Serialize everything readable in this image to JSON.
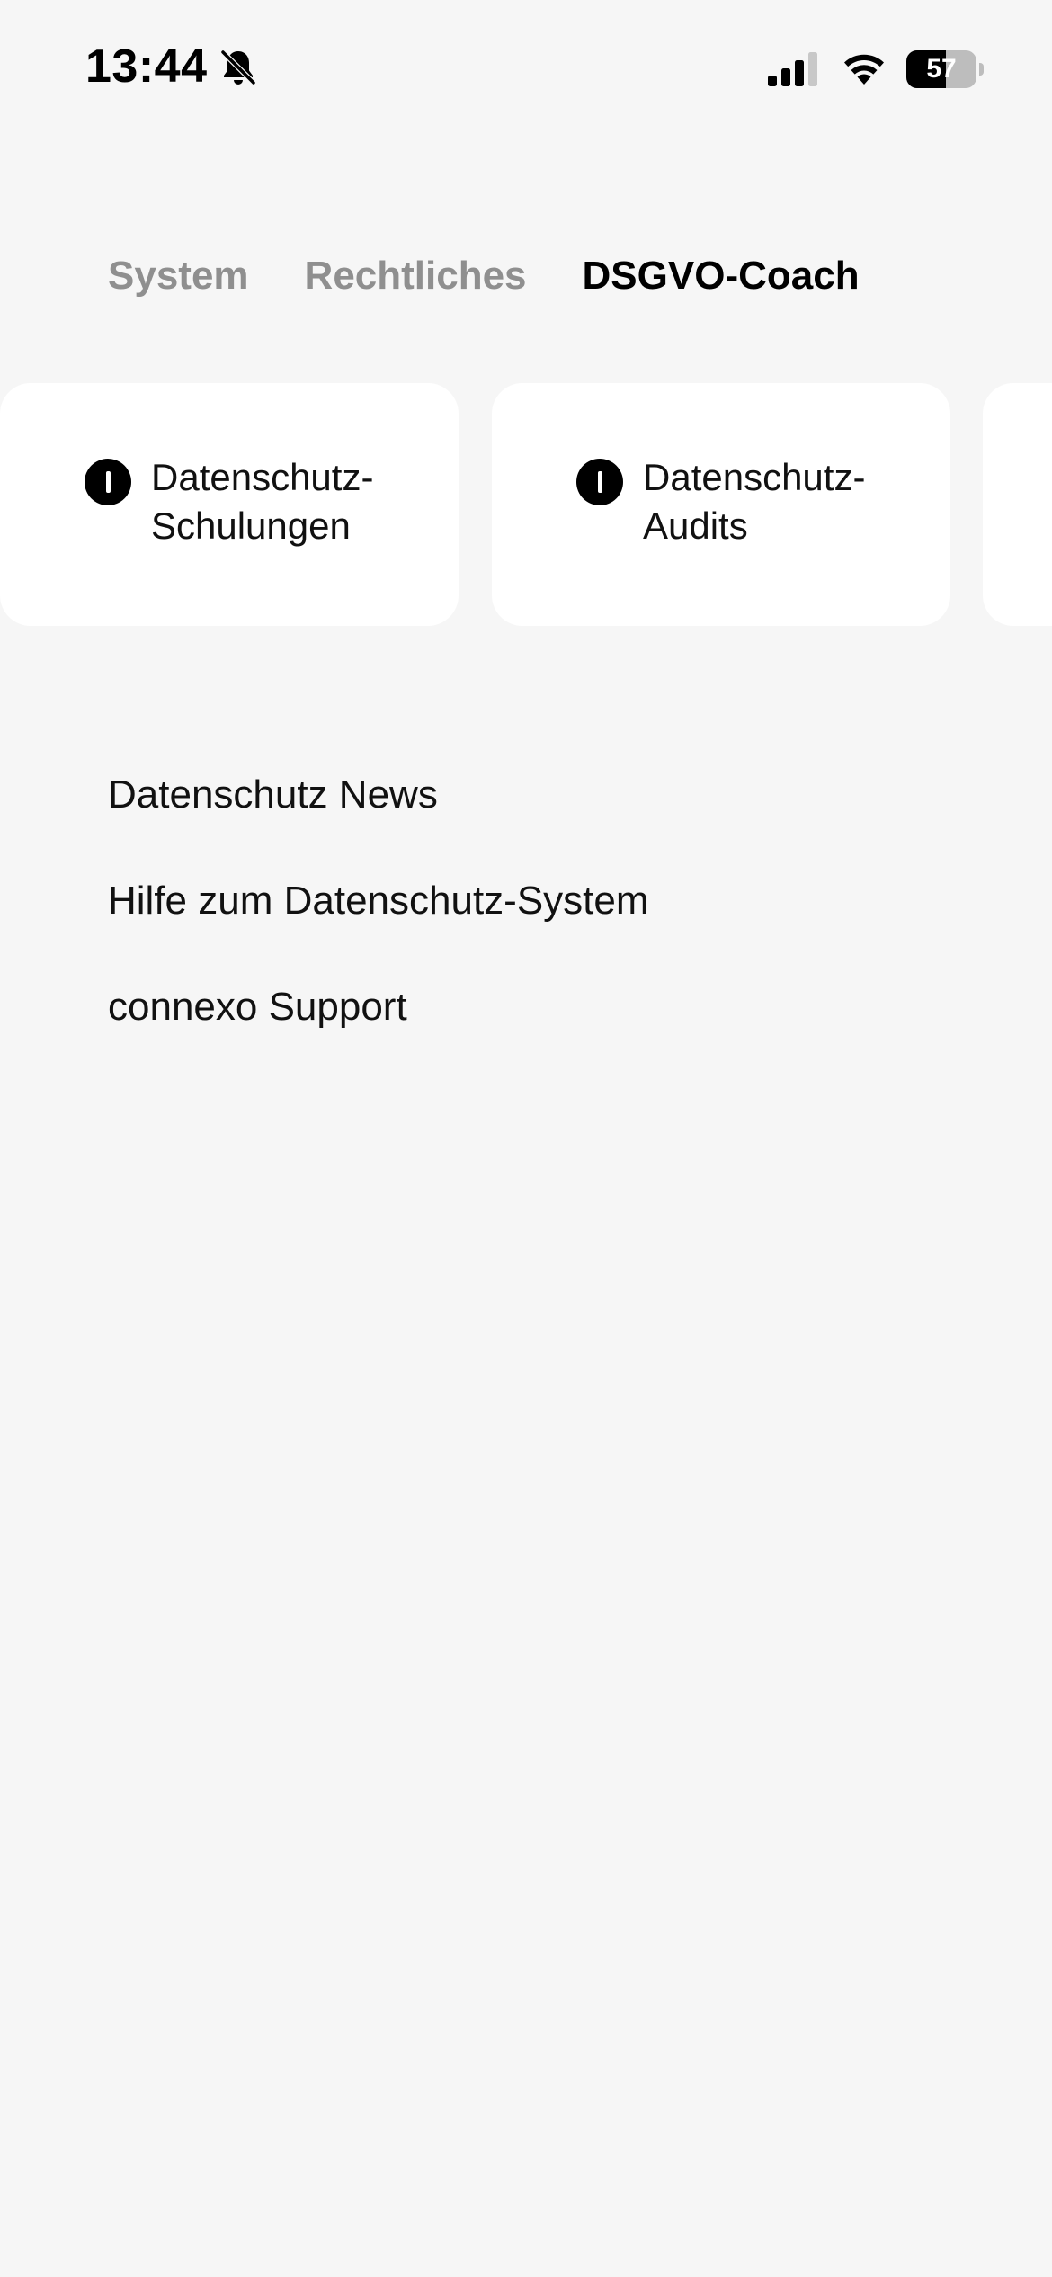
{
  "status_bar": {
    "time": "13:44",
    "battery_level": "57",
    "icons": [
      "bell-slash-icon",
      "cellular-signal-icon",
      "wifi-icon",
      "battery-icon"
    ]
  },
  "tabs": [
    {
      "label": "System",
      "active": false
    },
    {
      "label": "Rechtliches",
      "active": false
    },
    {
      "label": "DSGVO-Coach",
      "active": true
    }
  ],
  "cards": [
    {
      "label": "Datenschutz-\nSchulungen",
      "icon": "info-icon"
    },
    {
      "label": "Datenschutz-\nAudits",
      "icon": "info-icon"
    },
    {
      "label": "",
      "icon": ""
    }
  ],
  "links": [
    {
      "label": "Datenschutz News"
    },
    {
      "label": "Hilfe zum Datenschutz-System"
    },
    {
      "label": "connexo Support"
    }
  ],
  "colors": {
    "background": "#f6f6f6",
    "card": "#ffffff",
    "tab_inactive": "#8f8f8f",
    "tab_active": "#000000"
  }
}
